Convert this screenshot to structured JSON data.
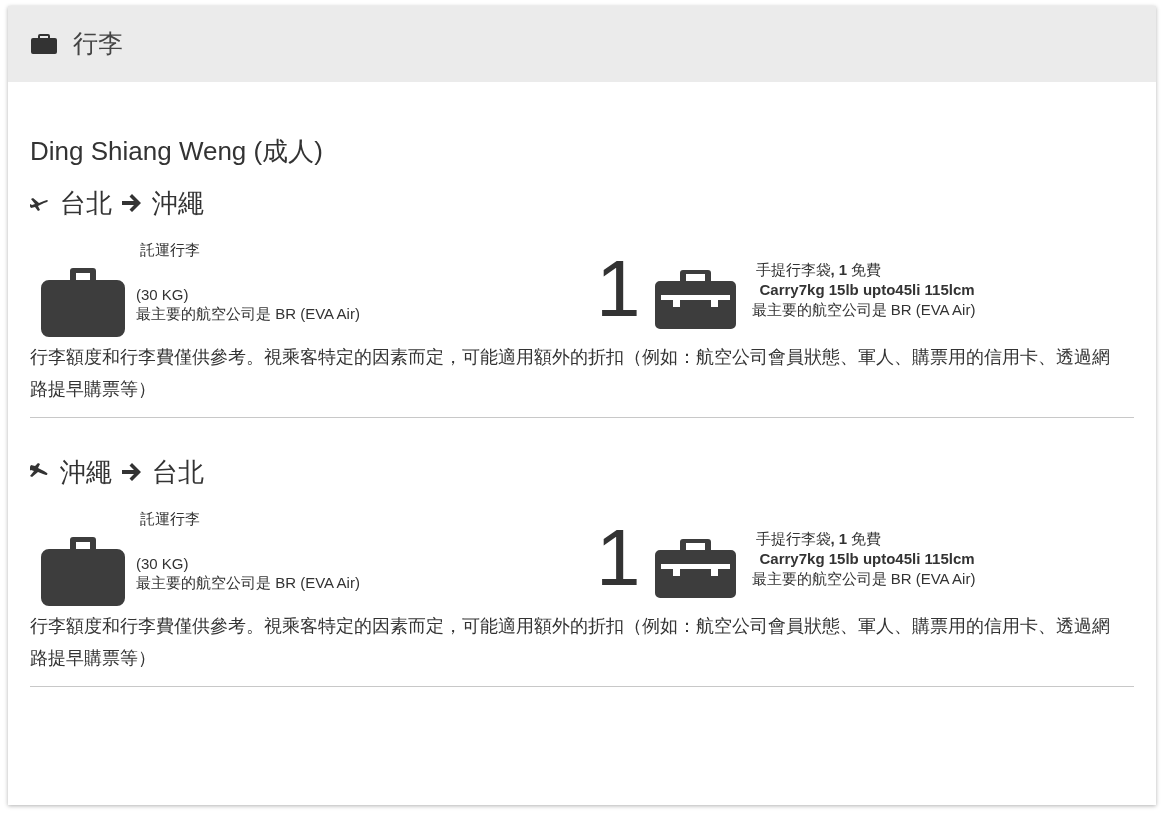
{
  "header": {
    "title": "行李"
  },
  "passenger": {
    "name": "Ding Shiang Weng (成人)"
  },
  "legs": [
    {
      "kind": "takeoff",
      "from": "台北",
      "to": "沖繩",
      "checked": {
        "label": "託運行李",
        "weight": "(30 KG)",
        "airline": "最主要的航空公司是 BR (EVA Air)"
      },
      "carry_on": {
        "count": "1",
        "title": "手提行李袋**, 1** 免費",
        "detail": "Carry7kg 15lb upto45li 115lcm",
        "airline": "最主要的航空公司是 BR (EVA Air)"
      },
      "note": "行李額度和行李費僅供參考。視乘客特定的因素而定，可能適用額外的折扣（例如：航空公司會員狀態、軍人、購票用的信用卡、透過網路提早購票等）"
    },
    {
      "kind": "landing",
      "from": "沖繩",
      "to": "台北",
      "checked": {
        "label": "託運行李",
        "weight": "(30 KG)",
        "airline": "最主要的航空公司是 BR (EVA Air)"
      },
      "carry_on": {
        "count": "1",
        "title": "手提行李袋**, 1** 免費",
        "detail": "Carry7kg 15lb upto45li 115lcm",
        "airline": "最主要的航空公司是 BR (EVA Air)"
      },
      "note": "行李額度和行李費僅供參考。視乘客特定的因素而定，可能適用額外的折扣（例如：航空公司會員狀態、軍人、購票用的信用卡、透過網路提早購票等）"
    }
  ]
}
